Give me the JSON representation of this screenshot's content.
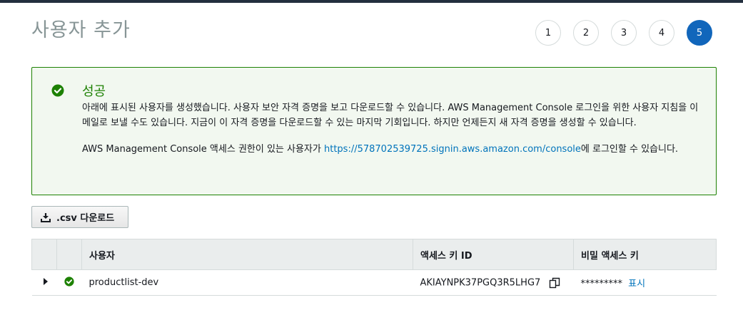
{
  "page": {
    "title": "사용자 추가",
    "steps": [
      "1",
      "2",
      "3",
      "4",
      "5"
    ],
    "active_step": "5"
  },
  "alert": {
    "title": "성공",
    "body": "아래에 표시된 사용자를 생성했습니다. 사용자 보안 자격 증명을 보고 다운로드할 수 있습니다. AWS Management Console 로그인을 위한 사용자 지침을 이메일로 보낼 수도 있습니다. 지금이 이 자격 증명을 다운로드할 수 있는 마지막 기회입니다. 하지만 언제든지 새 자격 증명을 생성할 수 있습니다.",
    "console_prefix": "AWS Management Console 액세스 권한이 있는 사용자가 ",
    "console_link": "https://578702539725.signin.aws.amazon.com/console",
    "console_suffix": "에 로그인할 수 있습니다.",
    "icon": "check-circle-icon",
    "color": "#1d8102"
  },
  "download_button": {
    "label": ".csv 다운로드",
    "icon": "download-icon"
  },
  "table": {
    "columns": [
      "",
      "",
      "사용자",
      "액세스 키 ID",
      "비밀 액세스 키"
    ],
    "rows": [
      {
        "user": "productlist-dev",
        "access_key_id": "AKIAYNPK37PGQ3R5LHG7",
        "secret_masked": "*********",
        "show_label": "표시"
      }
    ]
  },
  "colors": {
    "accent": "#1166bb",
    "success": "#1d8102",
    "link": "#0073bb"
  }
}
